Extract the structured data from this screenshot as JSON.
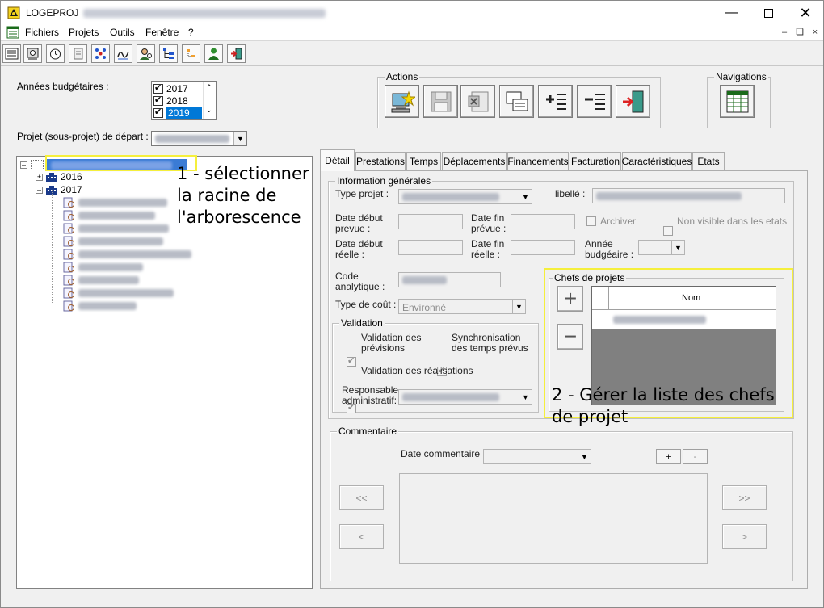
{
  "window": {
    "app_name": "LOGEPROJ",
    "minimize_icon": "minimize-icon",
    "maximize_icon": "maximize-icon",
    "close_icon": "close-icon"
  },
  "menu": {
    "items": [
      "Fichiers",
      "Projets",
      "Outils",
      "Fenêtre",
      "?"
    ]
  },
  "toolbar": {
    "icons": [
      "list-icon",
      "report-icon",
      "clock-icon",
      "document-icon",
      "network-icon",
      "signature-icon",
      "user-search-icon",
      "hierarchy-icon",
      "tree-edit-icon",
      "users-icon",
      "exit-icon"
    ]
  },
  "left": {
    "years_label": "Années budgétaires :",
    "years": [
      {
        "label": "2017",
        "checked": true,
        "selected": false
      },
      {
        "label": "2018",
        "checked": true,
        "selected": false
      },
      {
        "label": "2019",
        "checked": true,
        "selected": true
      }
    ],
    "project_label": "Projet (sous-projet) de départ :",
    "tree": {
      "years": [
        "2016",
        "2017"
      ]
    }
  },
  "actions": {
    "title": "Actions",
    "navigations_title": "Navigations"
  },
  "annotations": {
    "one_line1": "1 - sélectionner",
    "one_line2": "la racine de",
    "one_line3": "l'arborescence",
    "two_line1": "2 - Gérer la liste des chefs",
    "two_line2": "de projet"
  },
  "tabs": [
    "Détail",
    "Prestations",
    "Temps",
    "Déplacements",
    "Financements",
    "Facturation",
    "Caractéristiques",
    "Etats"
  ],
  "detail": {
    "info_title": "Information générales",
    "type_label": "Type  projet :",
    "libelle_label": "libellé :",
    "date_debut_prevue": "Date début\nprevue :",
    "date_fin_prevue": "Date fin\nprévue :",
    "archiver": "Archiver",
    "non_visible": "Non visible dans les etats",
    "date_debut_reelle": "Date début\nréelle :",
    "date_fin_reelle": "Date fin\nréelle :",
    "annee_budgetaire": "Année\nbudgéaire :",
    "code_analytique": "Code\nanalytique :",
    "type_cout_label": "Type de coût :",
    "type_cout_value": "Environné",
    "validation_title": "Validation",
    "validation_previsions": "Validation des\nprévisions",
    "synchro_temps": "Synchronisation\ndes temps prévus",
    "validation_realisations": "Validation des réalisations",
    "responsable": "Responsable\nadministratif:",
    "chefs_title": "Chefs de projets",
    "nom_header": "Nom",
    "comment_title": "Commentaire",
    "date_commentaire": "Date commentaire :",
    "plus": "+",
    "minus": "-",
    "first": "<<",
    "prev": "<",
    "last": ">>",
    "next": ">"
  }
}
